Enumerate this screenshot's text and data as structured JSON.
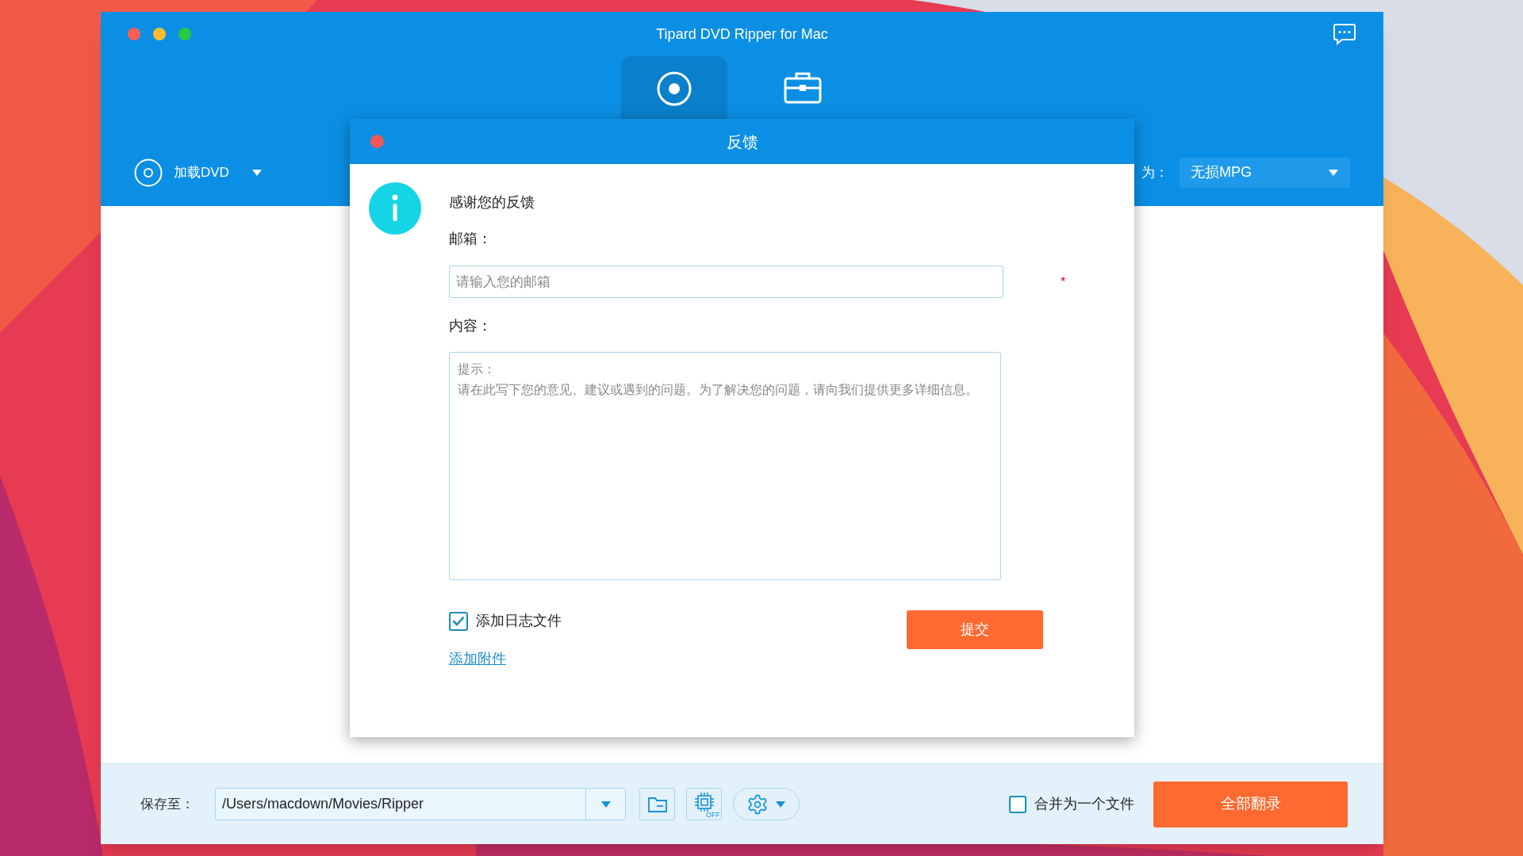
{
  "window": {
    "title": "Tipard DVD Ripper for Mac"
  },
  "tabs": [
    {
      "kind": "disc",
      "selected": true
    },
    {
      "kind": "toolbox",
      "selected": false
    }
  ],
  "toolbar": {
    "load_button": "加载DVD",
    "format_label": "为：",
    "format_value": "无损MPG"
  },
  "dialog": {
    "title": "反馈",
    "heading": "感谢您的反馈",
    "email_label": "邮箱：",
    "email_placeholder": "请输入您的邮箱",
    "required_mark": "*",
    "content_label": "内容：",
    "content_hint_title": "提示：",
    "content_hint_text": "请在此写下您的意见、建议或遇到的问题。为了解决您的问题，请向我们提供更多详细信息。",
    "log_checkbox": {
      "label": "添加日志文件",
      "checked": true
    },
    "attach_link": "添加附件",
    "submit": "提交"
  },
  "bottom_bar": {
    "save_label": "保存至：",
    "save_path": "/Users/macdown/Movies/Ripper",
    "hw_accel_label": "OFF",
    "merge_checkbox": {
      "label": "合并为一个文件",
      "checked": false
    },
    "rip_all": "全部翻录"
  }
}
